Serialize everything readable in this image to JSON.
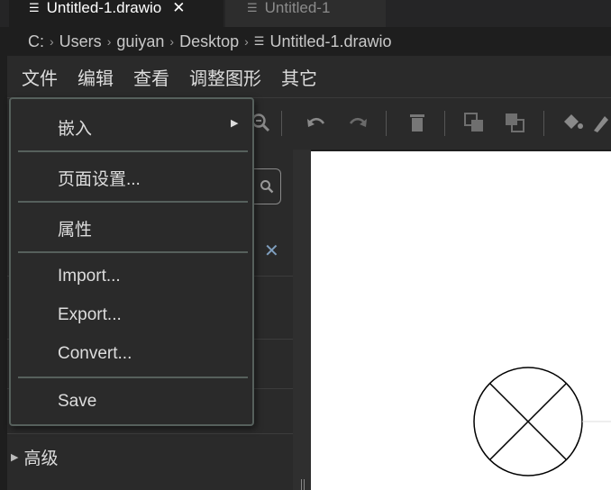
{
  "tabs": [
    {
      "label": "Untitled-1.drawio",
      "icon": "file-lines-icon",
      "active": true,
      "close_glyph": "✕"
    },
    {
      "label": "Untitled-1",
      "icon": "file-lines-icon",
      "active": false
    }
  ],
  "breadcrumb": {
    "parts": [
      "C:",
      "Users",
      "guiyan",
      "Desktop",
      "Untitled-1.drawio"
    ],
    "separator": "›"
  },
  "menubar": {
    "items": [
      "文件",
      "编辑",
      "查看",
      "调整图形",
      "其它"
    ]
  },
  "dropdown": {
    "items": [
      {
        "label": "嵌入",
        "has_submenu": true
      },
      {
        "label": "页面设置..."
      },
      {
        "label": "属性"
      },
      {
        "label": "Import..."
      },
      {
        "label": "Export..."
      },
      {
        "label": "Convert..."
      },
      {
        "label": "Save"
      }
    ],
    "submenu_arrow": "▶"
  },
  "sidebar": {
    "advanced_label": "高级",
    "close_glyph": "✕"
  },
  "toolbar": {
    "icons": [
      "zoom-out-icon",
      "undo-icon",
      "redo-icon",
      "delete-icon",
      "to-front-icon",
      "to-back-icon",
      "fill-color-icon"
    ]
  },
  "colors": {
    "background": "#1e1e1e",
    "panel": "#2a2a2a",
    "menu_border": "#56605c",
    "canvas": "#ffffff"
  }
}
